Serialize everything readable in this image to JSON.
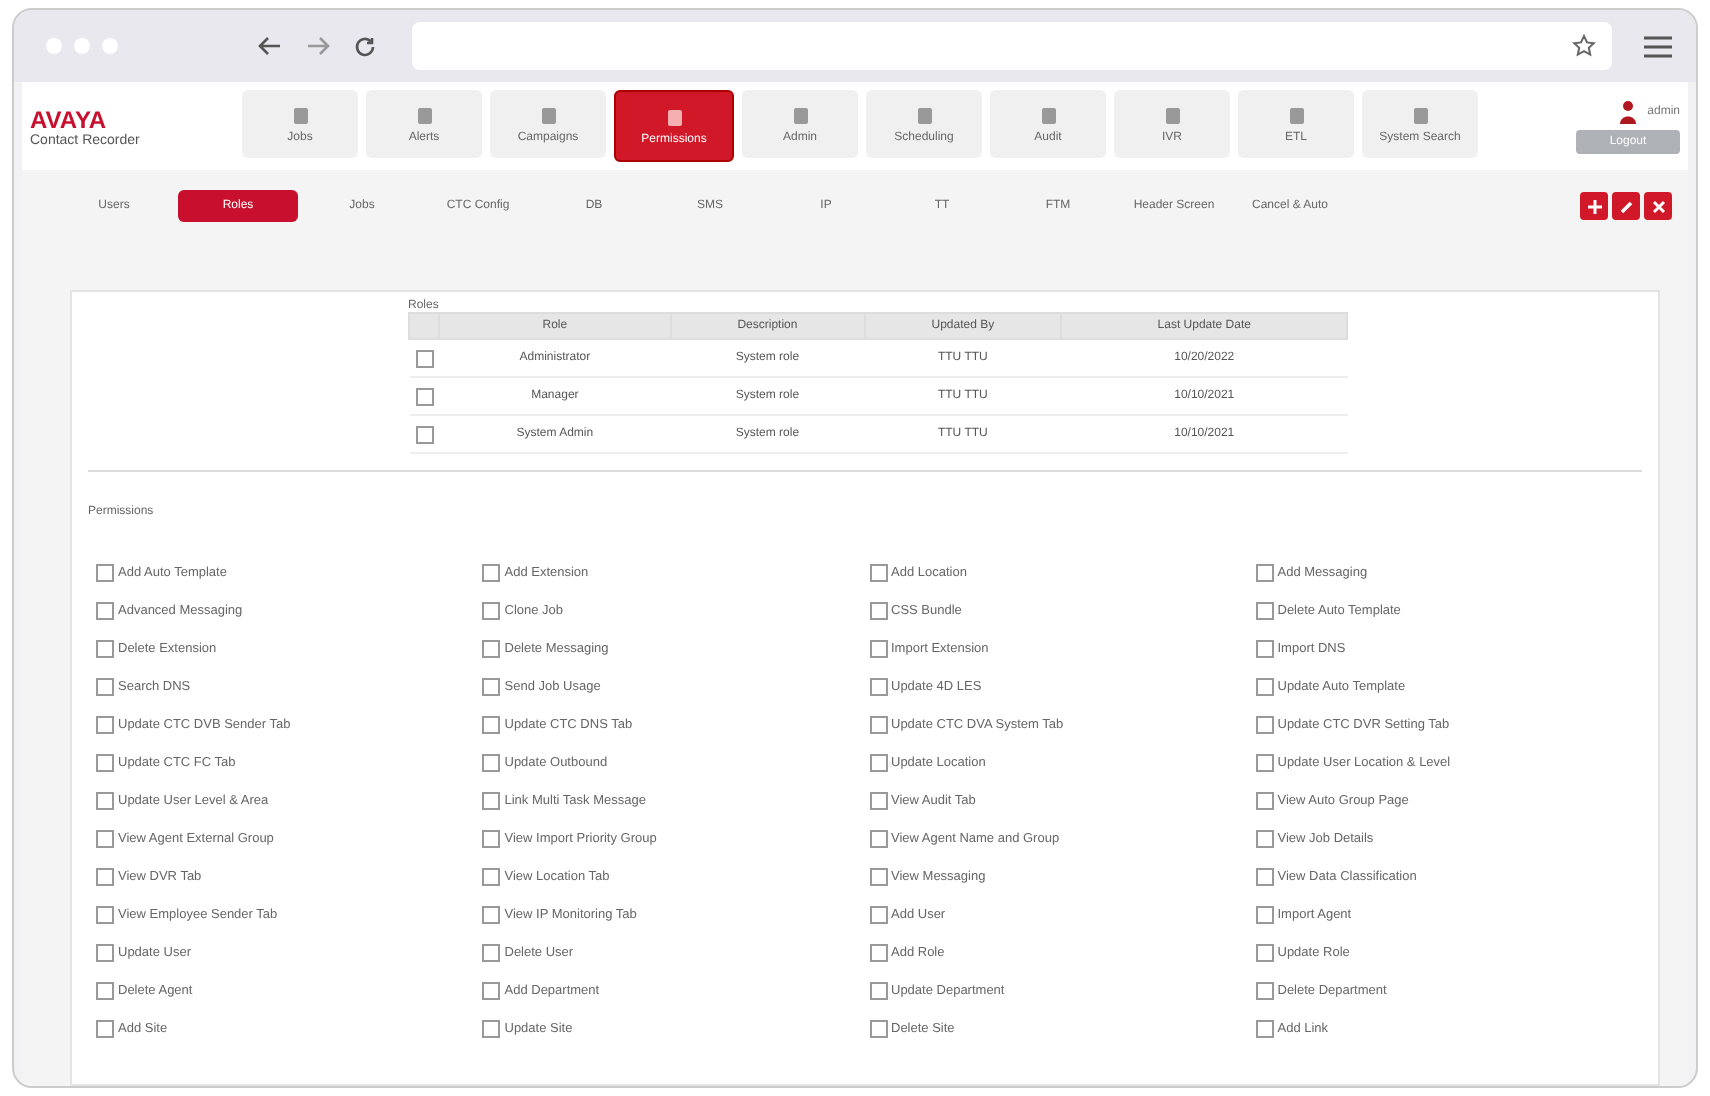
{
  "app": {
    "logo": "AVAYA",
    "subtitle": "Contact Recorder",
    "user": "admin",
    "logout": "Logout"
  },
  "nav": [
    {
      "label": "Jobs",
      "selected": false
    },
    {
      "label": "Alerts",
      "selected": false
    },
    {
      "label": "Campaigns",
      "selected": false
    },
    {
      "label": "Permissions",
      "selected": true
    },
    {
      "label": "Admin",
      "selected": false
    },
    {
      "label": "Scheduling",
      "selected": false
    },
    {
      "label": "Audit",
      "selected": false
    },
    {
      "label": "IVR",
      "selected": false
    },
    {
      "label": "ETL",
      "selected": false
    },
    {
      "label": "System Search",
      "selected": false
    }
  ],
  "subnav": [
    {
      "label": "Users",
      "selected": false
    },
    {
      "label": "Roles",
      "selected": true
    },
    {
      "label": "Jobs",
      "selected": false
    },
    {
      "label": "CTC Config",
      "selected": false
    },
    {
      "label": "DB",
      "selected": false
    },
    {
      "label": "SMS",
      "selected": false
    },
    {
      "label": "IP",
      "selected": false
    },
    {
      "label": "TT",
      "selected": false
    },
    {
      "label": "FTM",
      "selected": false
    },
    {
      "label": "Header Screen",
      "selected": false
    },
    {
      "label": "Cancel & Auto",
      "selected": false
    }
  ],
  "roles": {
    "title": "Roles",
    "columns": [
      "Role",
      "Description",
      "Updated By",
      "Last Update Date"
    ],
    "rows": [
      {
        "checked": false,
        "cells": [
          "Administrator",
          "System role",
          "TTU TTU",
          "10/20/2022"
        ]
      },
      {
        "checked": false,
        "cells": [
          "Manager",
          "System role",
          "TTU TTU",
          "10/10/2021"
        ]
      },
      {
        "checked": false,
        "cells": [
          "System Admin",
          "System role",
          "TTU TTU",
          "10/10/2021"
        ]
      }
    ]
  },
  "permissions": {
    "title": "Permissions",
    "items": [
      {
        "label": "Add Auto Template",
        "checked": false
      },
      {
        "label": "Add Extension",
        "checked": false
      },
      {
        "label": "Add Location",
        "checked": false
      },
      {
        "label": "Add Messaging",
        "checked": false
      },
      {
        "label": "Advanced Messaging",
        "checked": false
      },
      {
        "label": "Clone Job",
        "checked": false
      },
      {
        "label": "CSS Bundle",
        "checked": false
      },
      {
        "label": "Delete Auto Template",
        "checked": false
      },
      {
        "label": "Delete Extension",
        "checked": false
      },
      {
        "label": "Delete Messaging",
        "checked": false
      },
      {
        "label": "Import Extension",
        "checked": false
      },
      {
        "label": "Import DNS",
        "checked": false
      },
      {
        "label": "Search DNS",
        "checked": false
      },
      {
        "label": "Send Job Usage",
        "checked": false
      },
      {
        "label": "Update 4D LES",
        "checked": false
      },
      {
        "label": "Update Auto Template",
        "checked": false
      },
      {
        "label": "Update CTC DVB Sender Tab",
        "checked": false
      },
      {
        "label": "Update CTC DNS Tab",
        "checked": false
      },
      {
        "label": "Update CTC DVA System Tab",
        "checked": false
      },
      {
        "label": "Update CTC DVR Setting Tab",
        "checked": false
      },
      {
        "label": "Update CTC FC Tab",
        "checked": false
      },
      {
        "label": "Update Outbound",
        "checked": false
      },
      {
        "label": "Update Location",
        "checked": false
      },
      {
        "label": "Update User Location & Level",
        "checked": false
      },
      {
        "label": "Update User Level & Area",
        "checked": false
      },
      {
        "label": "Link Multi Task Message",
        "checked": false
      },
      {
        "label": "View Audit Tab",
        "checked": false
      },
      {
        "label": "View Auto Group Page",
        "checked": false
      },
      {
        "label": "View Agent External Group",
        "checked": false
      },
      {
        "label": "View Import Priority Group",
        "checked": false
      },
      {
        "label": "View Agent Name and Group",
        "checked": false
      },
      {
        "label": "View Job Details",
        "checked": false
      },
      {
        "label": "View DVR Tab",
        "checked": false
      },
      {
        "label": "View Location Tab",
        "checked": false
      },
      {
        "label": "View Messaging",
        "checked": false
      },
      {
        "label": "View Data Classification",
        "checked": false
      },
      {
        "label": "View Employee Sender Tab",
        "checked": false
      },
      {
        "label": "View IP Monitoring Tab",
        "checked": false
      },
      {
        "label": "Add User",
        "checked": false
      },
      {
        "label": "Import Agent",
        "checked": false
      },
      {
        "label": "Update User",
        "checked": false
      },
      {
        "label": "Delete User",
        "checked": false
      },
      {
        "label": "Add Role",
        "checked": false
      },
      {
        "label": "Update Role",
        "checked": false
      },
      {
        "label": "Delete Agent",
        "checked": false
      },
      {
        "label": "Add Department",
        "checked": false
      },
      {
        "label": "Update Department",
        "checked": false
      },
      {
        "label": "Delete Department",
        "checked": false
      },
      {
        "label": "Add Site",
        "checked": false
      },
      {
        "label": "Update Site",
        "checked": false
      },
      {
        "label": "Delete Site",
        "checked": false
      },
      {
        "label": "Add Link",
        "checked": false
      }
    ]
  }
}
